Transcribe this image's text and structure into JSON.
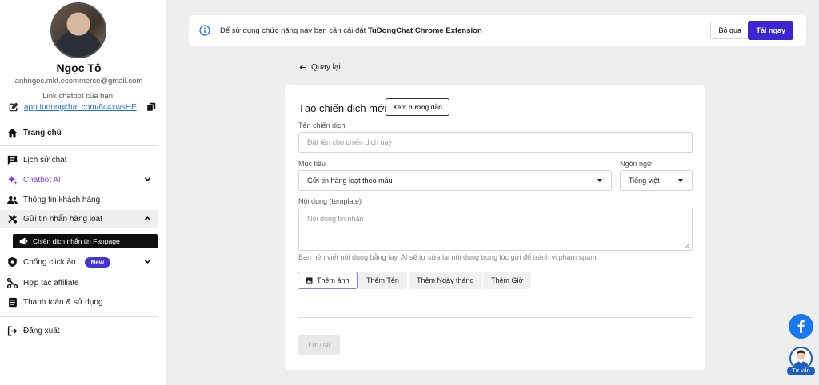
{
  "user": {
    "name": "Ngọc Tô",
    "email": "anhngoc.mkt.ecommerce@gmail.com",
    "link_label": "Link chatbot của bạn:",
    "link_url": "app.tudongchat.com/6c4xwsHE"
  },
  "nav": {
    "home": "Trang chủ",
    "chat_history": "Lịch sử chat",
    "chatbot_ai": "Chatbot AI",
    "customer_info": "Thông tin khách hàng",
    "bulk_message": "Gửi tin nhắn hàng loạt",
    "fanpage_campaign": "Chiến dịch nhắn tin Fanpage",
    "anti_click": "Chống click ảo",
    "new_badge": "New",
    "affiliate": "Hợp tác affiliate",
    "billing": "Thanh toán & sử dụng",
    "logout": "Đăng xuất"
  },
  "banner": {
    "text_prefix": "Để sử dụng chức năng này bạn cần cài đặt ",
    "text_bold": "TuDongChat Chrome Extension",
    "skip_label": "Bỏ qua",
    "download_label": "Tải ngay"
  },
  "back_label": "Quay lại",
  "form": {
    "title": "Tạo chiến dịch mới",
    "guide_label": "Xem hướng dẫn",
    "name_label": "Tên chiến dịch",
    "name_placeholder": "Đặt tên cho chiến dịch này",
    "goal_label": "Mục tiêu",
    "goal_value": "Gửi tin hàng loạt theo mẫu",
    "language_label": "Ngôn ngữ",
    "language_value": "Tiếng việt",
    "content_label": "Nội dung (template)",
    "content_placeholder": "Nội dung tin nhắn",
    "hint": "Bạn nên viết nội dung bằng tay, AI sẽ tự sửa lại nội dung trong lúc gửi để tránh vi phạm spam.",
    "chips": [
      "Thêm ảnh",
      "Thêm Tên",
      "Thêm Ngày tháng",
      "Thêm Giờ"
    ],
    "save_label": "Lưu lại"
  },
  "consult_label": "Tư vấn",
  "colors": {
    "accent": "#3c26d4",
    "link": "#1a73e8",
    "facebook": "#1877f2"
  }
}
